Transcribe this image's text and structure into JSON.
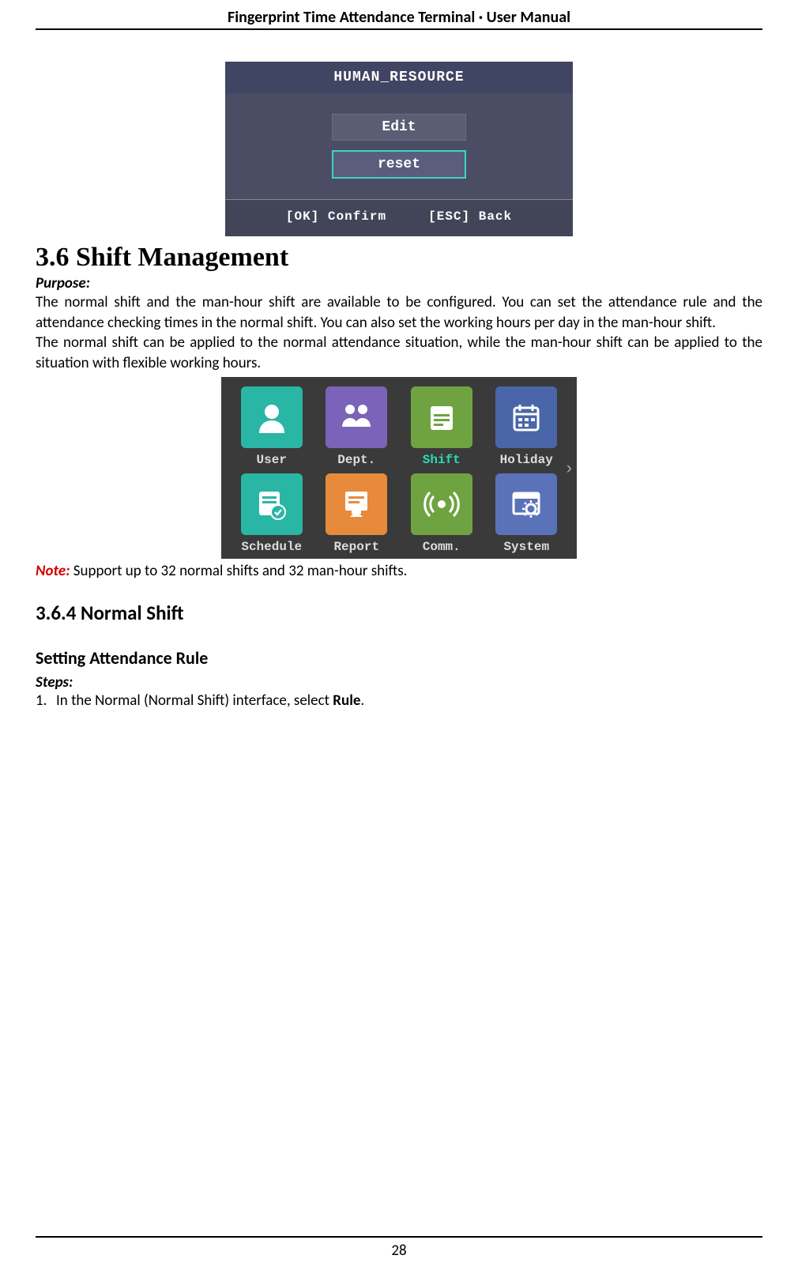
{
  "header": {
    "title": "Fingerprint Time Attendance Terminal · User Manual"
  },
  "device1": {
    "title": "HUMAN_RESOURCE",
    "buttons": [
      {
        "label": "Edit",
        "selected": false
      },
      {
        "label": "reset",
        "selected": true
      }
    ],
    "footer_confirm": "[OK] Confirm",
    "footer_back": "[ESC] Back"
  },
  "section": {
    "heading": "3.6 Shift Management",
    "purpose_label": "Purpose:",
    "purpose_p1": "The normal shift and the man-hour shift are available to be configured. You can set the attendance rule and the attendance checking times in the normal shift. You can also set the working hours per day in the man-hour shift.",
    "purpose_p2": "The normal shift can be applied to the normal attendance situation, while the man-hour shift can be applied to the situation with flexible working hours."
  },
  "device2": {
    "items": [
      {
        "label": "User",
        "color": "#29b6a5",
        "icon": "user"
      },
      {
        "label": "Dept.",
        "color": "#7a63b8",
        "icon": "dept"
      },
      {
        "label": "Shift",
        "color": "#6fa341",
        "icon": "shift",
        "selected": true
      },
      {
        "label": "Holiday",
        "color": "#4a66a8",
        "icon": "holiday"
      },
      {
        "label": "Schedule",
        "color": "#29b6a5",
        "icon": "schedule"
      },
      {
        "label": "Report",
        "color": "#e88a3c",
        "icon": "report"
      },
      {
        "label": "Comm.",
        "color": "#6fa341",
        "icon": "comm"
      },
      {
        "label": "System",
        "color": "#5a73b8",
        "icon": "system"
      }
    ]
  },
  "note": {
    "label": "Note:",
    "text": " Support up to 32 normal shifts and 32 man-hour shifts."
  },
  "sub1": {
    "heading": "3.6.4   Normal Shift"
  },
  "sub2": {
    "heading": "Setting Attendance Rule",
    "steps_label": "Steps:",
    "step1_prefix": "1.",
    "step1_a": "In the Normal (Normal Shift) interface, select ",
    "step1_b": "Rule",
    "step1_c": "."
  },
  "page_number": "28"
}
